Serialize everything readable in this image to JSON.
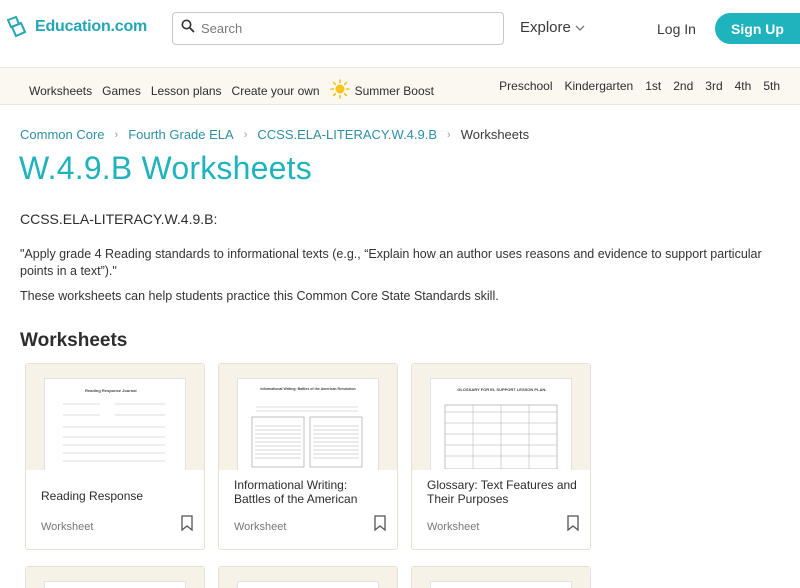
{
  "header": {
    "logo_text": "Education.com",
    "search_placeholder": "Search",
    "explore_label": "Explore",
    "login_label": "Log In",
    "signup_label": "Sign Up"
  },
  "nav": {
    "left_items": [
      "Worksheets",
      "Games",
      "Lesson plans",
      "Create your own"
    ],
    "summer_label": "Summer Boost",
    "grades": [
      "Preschool",
      "Kindergarten",
      "1st",
      "2nd",
      "3rd",
      "4th",
      "5th"
    ]
  },
  "breadcrumb": {
    "items": [
      "Common Core",
      "Fourth Grade ELA",
      "CCSS.ELA-LITERACY.W.4.9.B"
    ],
    "current": "Worksheets"
  },
  "page": {
    "title": "W.4.9.B Worksheets",
    "standard_code": "CCSS.ELA-LITERACY.W.4.9.B:",
    "standard_desc": "\"Apply grade 4 Reading standards to informational texts (e.g., “Explain how an author uses reasons and evidence to support particular points in a text”).\"",
    "help_text": "These worksheets can help students practice this Common Core State Standards skill.",
    "section_title": "Worksheets"
  },
  "cards": [
    {
      "title": "Reading Response",
      "type": "Worksheet",
      "thumb_heading": "Reading Response Journal"
    },
    {
      "title": "Informational Writing: Battles of the American",
      "type": "Worksheet",
      "thumb_heading": "Informational Writing: Battles of the American Revolution"
    },
    {
      "title": "Glossary: Text Features and Their Purposes",
      "type": "Worksheet",
      "thumb_heading": "GLOSSARY FOR EL SUPPORT LESSON PLAN:"
    }
  ],
  "colors": {
    "brand_teal": "#1fb3bd",
    "link_teal": "#2e8fa6",
    "nav_bg": "#fbf8f2",
    "thumb_bg": "#f7f2e8"
  }
}
